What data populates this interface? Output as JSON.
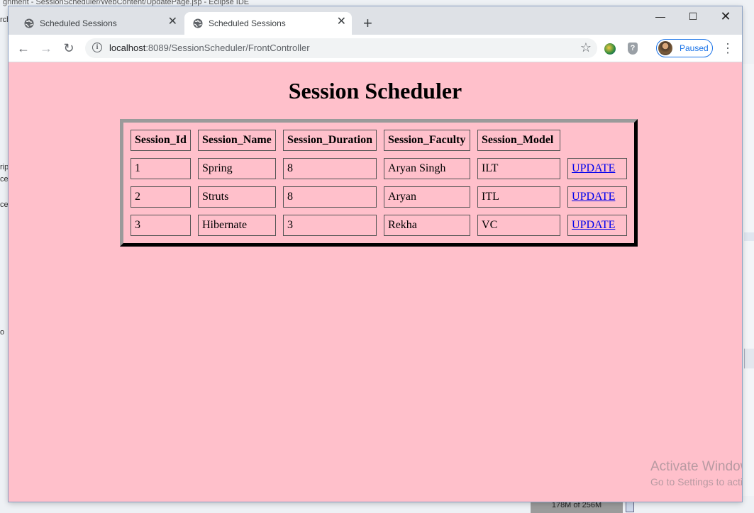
{
  "background": {
    "ide_title": "gnment - SessionScheduler/WebContent/UpdatePage.jsp - Eclipse IDE",
    "edge_fragments": [
      "rch",
      "rip",
      "ce",
      "ces",
      "o"
    ],
    "status_text": "178M of 256M"
  },
  "browser": {
    "tabs": [
      {
        "title": "Scheduled Sessions",
        "active": false
      },
      {
        "title": "Scheduled Sessions",
        "active": true
      }
    ],
    "new_tab": "+",
    "window_controls": {
      "minimize": "—",
      "maximize": "☐",
      "close": "✕"
    },
    "url_host": "localhost",
    "url_rest": ":8089/SessionScheduler/FrontController",
    "profile_label": "Paused"
  },
  "page": {
    "title": "Session Scheduler",
    "table": {
      "headers": [
        "Session_Id",
        "Session_Name",
        "Session_Duration",
        "Session_Faculty",
        "Session_Model"
      ],
      "rows": [
        {
          "id": "1",
          "name": "Spring",
          "duration": "8",
          "faculty": "Aryan Singh",
          "model": "ILT",
          "action": "UPDATE"
        },
        {
          "id": "2",
          "name": "Struts",
          "duration": "8",
          "faculty": "Aryan",
          "model": "ITL",
          "action": "UPDATE"
        },
        {
          "id": "3",
          "name": "Hibernate",
          "duration": "3",
          "faculty": "Rekha",
          "model": "VC",
          "action": "UPDATE"
        }
      ]
    }
  },
  "watermark": {
    "line1": "Activate Windows",
    "line2": "Go to Settings to activate Windows."
  },
  "colors": {
    "page_bg": "#ffc0cb",
    "link": "#0000ee",
    "profile_accent": "#1a73e8"
  }
}
